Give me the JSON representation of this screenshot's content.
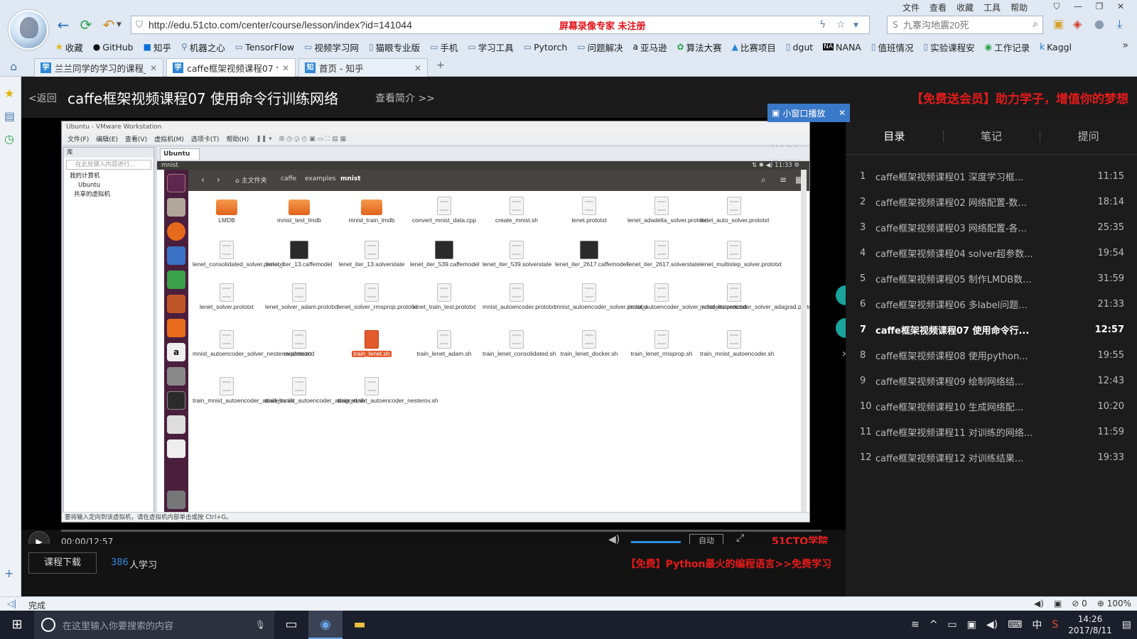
{
  "browser": {
    "url": "http://edu.51cto.com/center/course/lesson/index?id=141044",
    "recorder_note": "屏幕录像专家  未注册",
    "search_placeholder": "九寨沟地震20死",
    "menu": [
      "文件",
      "查看",
      "收藏",
      "工具",
      "帮助"
    ],
    "bookmarks": [
      "收藏",
      "GitHub",
      "知乎",
      "机器之心",
      "TensorFlow",
      "视频学习网",
      "猫眼专业版",
      "手机",
      "学习工具",
      "Pytorch",
      "问题解决",
      "亚马逊",
      "算法大赛",
      "比赛项目",
      "dgut",
      "NANA",
      "值班情况",
      "实验课程安",
      "工作记录",
      "Kaggl"
    ],
    "tabs": [
      {
        "label": "兰兰同学的学习的课程_",
        "icon": "51cto-tab-icon"
      },
      {
        "label": "caffe框架视频课程07 使",
        "icon": "51cto-tab-icon"
      },
      {
        "label": "首页 - 知乎",
        "icon": "zhihu-tab-icon"
      }
    ],
    "new_tab": "+",
    "status_text": "完成",
    "zoom": "100%",
    "status_count": "0"
  },
  "course": {
    "back_label": "<返回",
    "title": "caffe框架视频课程07 使用命令行训练网络",
    "intro_link": "查看简介 >>",
    "promo_top": "【免费送会员】助力学子，增值你的梦想",
    "mini_play_label": "小窗口播放",
    "download_label": "课程下载",
    "learners": "386",
    "learners_label": "人学习",
    "promo_bottom": "【免费】Python最火的编程语言>>免费学习"
  },
  "player": {
    "time": "00:00/12:57",
    "quality": "自动",
    "logo": "51CTO学院",
    "progress": 0
  },
  "vm": {
    "title": "Ubuntu - VMware Workstation",
    "menu": [
      "文件(F)",
      "编辑(E)",
      "查看(V)",
      "虚拟机(M)",
      "选项卡(T)",
      "帮助(H)"
    ],
    "watermark": "51CTO学院",
    "library_title": "库",
    "library_search": "在此处键入内容进行...",
    "tree": [
      "我的计算机",
      "Ubuntu",
      "共享的虚拟机"
    ],
    "tab": "Ubuntu",
    "status": "要将输入定向到该虚拟机，请在虚拟机内部单击或按 Ctrl+G。",
    "ubuntu_panel_title": "mnist",
    "ubuntu_time": "11:33",
    "breadcrumbs": [
      "主文件夹",
      "caffe",
      "examples",
      "mnist"
    ],
    "files": [
      {
        "name": "LMDB",
        "type": "folder"
      },
      {
        "name": "mnist_test_lmdb",
        "type": "folder"
      },
      {
        "name": "mnist_train_lmdb",
        "type": "folder"
      },
      {
        "name": "convert_mnist_data.cpp",
        "type": "doc"
      },
      {
        "name": "create_mnist.sh",
        "type": "doc"
      },
      {
        "name": "lenet.prototxt",
        "type": "doc"
      },
      {
        "name": "lenet_adadelta_solver.prototxt",
        "type": "doc"
      },
      {
        "name": "lenet_auto_solver.prototxt",
        "type": "doc"
      },
      {
        "name": "lenet_consolidated_solver.prototxt",
        "type": "doc"
      },
      {
        "name": "lenet_iter_13.caffemodel",
        "type": "model"
      },
      {
        "name": "lenet_iter_13.solverstate",
        "type": "doc"
      },
      {
        "name": "lenet_iter_539.caffemodel",
        "type": "model"
      },
      {
        "name": "lenet_iter_539.solverstate",
        "type": "doc"
      },
      {
        "name": "lenet_iter_2617.caffemodel",
        "type": "model"
      },
      {
        "name": "lenet_iter_2617.solverstate",
        "type": "doc"
      },
      {
        "name": "lenet_multistep_solver.prototxt",
        "type": "doc"
      },
      {
        "name": "lenet_solver.prototxt",
        "type": "doc"
      },
      {
        "name": "lenet_solver_adam.prototxt",
        "type": "doc"
      },
      {
        "name": "lenet_solver_rmsprop.prototxt",
        "type": "doc"
      },
      {
        "name": "lenet_train_test.prototxt",
        "type": "doc"
      },
      {
        "name": "mnist_autoencoder.prototxt",
        "type": "doc"
      },
      {
        "name": "mnist_autoencoder_solver.prototxt",
        "type": "doc"
      },
      {
        "name": "mnist_autoencoder_solver_adadelta.prototxt",
        "type": "doc"
      },
      {
        "name": "mnist_autoencoder_solver_adagrad.prototxt",
        "type": "doc"
      },
      {
        "name": "mnist_autoencoder_solver_nesterov.prototxt",
        "type": "doc"
      },
      {
        "name": "readme.md",
        "type": "doc"
      },
      {
        "name": "train_lenet.sh",
        "type": "selected"
      },
      {
        "name": "train_lenet_adam.sh",
        "type": "doc"
      },
      {
        "name": "train_lenet_consolidated.sh",
        "type": "doc"
      },
      {
        "name": "train_lenet_docker.sh",
        "type": "doc"
      },
      {
        "name": "train_lenet_rmsprop.sh",
        "type": "doc"
      },
      {
        "name": "train_mnist_autoencoder.sh",
        "type": "doc"
      },
      {
        "name": "train_mnist_autoencoder_adadelta.sh",
        "type": "doc"
      },
      {
        "name": "train_mnist_autoencoder_adagrad.sh",
        "type": "doc"
      },
      {
        "name": "train_mnist_autoencoder_nesterov.sh",
        "type": "doc"
      }
    ]
  },
  "side_panel": {
    "tabs": [
      "目录",
      "笔记",
      "提问"
    ],
    "lessons": [
      {
        "num": "1",
        "title": "caffe框架视频课程01 深度学习框...",
        "duration": "11:15"
      },
      {
        "num": "2",
        "title": "caffe框架视频课程02 网络配置-数...",
        "duration": "18:14"
      },
      {
        "num": "3",
        "title": "caffe框架视频课程03 网络配置-各...",
        "duration": "25:35"
      },
      {
        "num": "4",
        "title": "caffe框架视频课程04 solver超参数...",
        "duration": "19:54"
      },
      {
        "num": "5",
        "title": "caffe框架视频课程05 制作LMDB数...",
        "duration": "31:59"
      },
      {
        "num": "6",
        "title": "caffe框架视频课程06 多label问题...",
        "duration": "21:33"
      },
      {
        "num": "7",
        "title": "caffe框架视频课程07 使用命令行...",
        "duration": "12:57",
        "current": true
      },
      {
        "num": "8",
        "title": "caffe框架视频课程08 使用python...",
        "duration": "19:55"
      },
      {
        "num": "9",
        "title": "caffe框架视频课程09 绘制网络结...",
        "duration": "12:43"
      },
      {
        "num": "10",
        "title": "caffe框架视频课程10 生成网络配...",
        "duration": "10:20"
      },
      {
        "num": "11",
        "title": "caffe框架视频课程11 对训练的网络...",
        "duration": "11:59"
      },
      {
        "num": "12",
        "title": "caffe框架视频课程12 对训练结果...",
        "duration": "19:33"
      }
    ]
  },
  "taskbar": {
    "search_placeholder": "在这里输入你要搜索的内容",
    "ime": "中",
    "time": "14:26",
    "date": "2017/8/11"
  }
}
